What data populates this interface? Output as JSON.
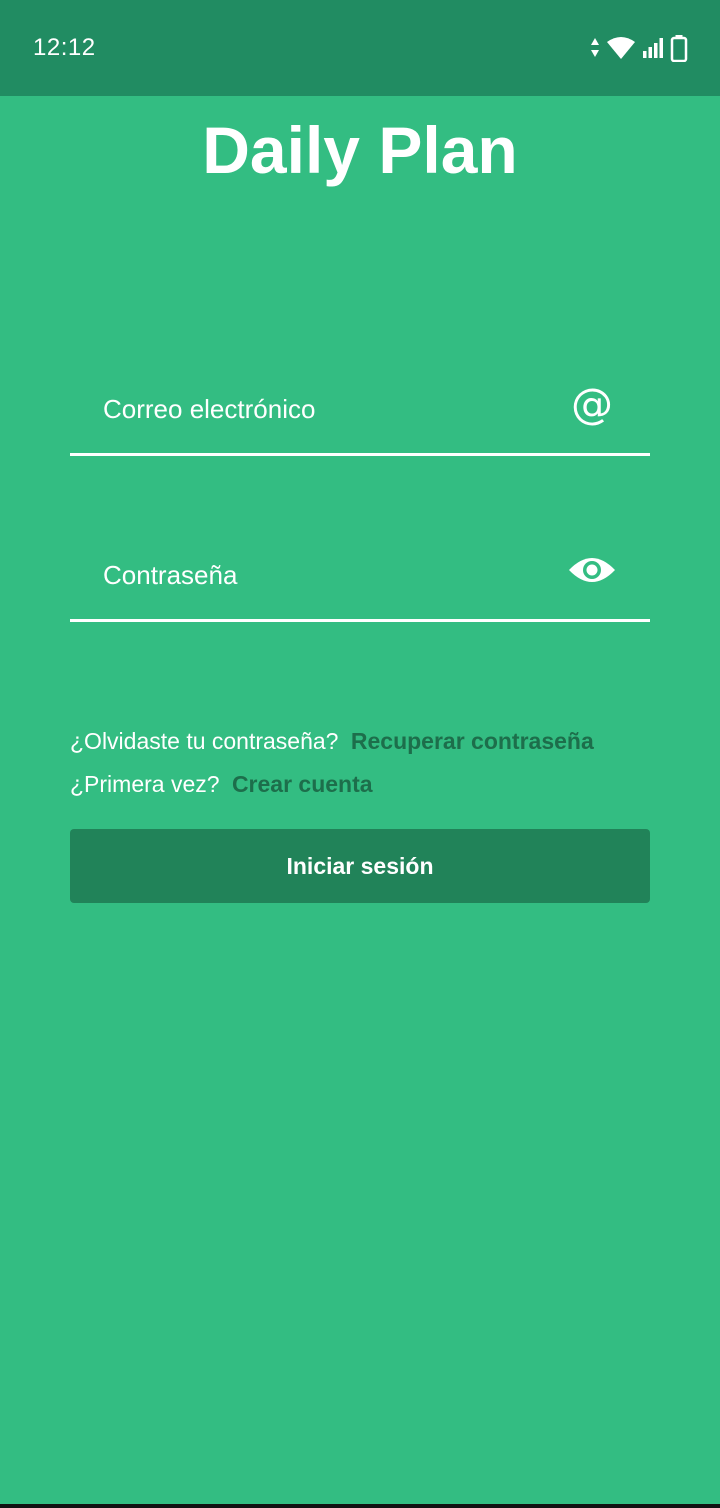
{
  "status_bar": {
    "time": "12:12",
    "icons": [
      "data-arrows-icon",
      "wifi-icon",
      "signal-icon",
      "battery-icon"
    ]
  },
  "app": {
    "title": "Daily Plan"
  },
  "login_form": {
    "email": {
      "placeholder": "Correo electrónico",
      "value": "",
      "icon": "at-sign-icon"
    },
    "password": {
      "placeholder": "Contraseña",
      "value": "",
      "icon": "eye-icon"
    },
    "forgot_prompt": "¿Olvidaste tu contraseña?",
    "forgot_link": "Recuperar contraseña",
    "first_time_prompt": "¿Primera vez?",
    "create_account_link": "Crear cuenta",
    "submit_label": "Iniciar sesión"
  },
  "colors": {
    "background": "#33bd82",
    "status_bar": "#218c62",
    "button": "#218359",
    "link": "#1d6e4b",
    "text": "#ffffff"
  }
}
